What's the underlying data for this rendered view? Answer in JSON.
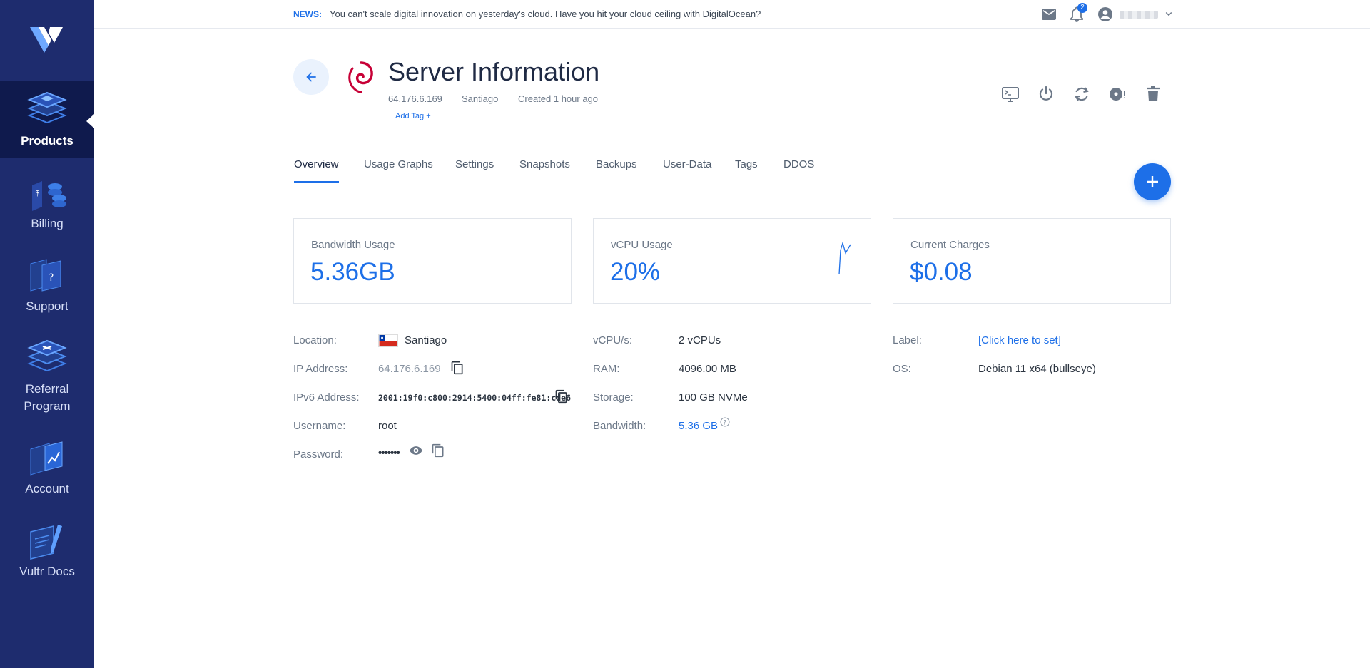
{
  "sidebar": {
    "items": [
      {
        "label": "Products",
        "icon": "products-icon",
        "active": true
      },
      {
        "label": "Billing",
        "icon": "billing-icon"
      },
      {
        "label": "Support",
        "icon": "support-icon"
      },
      {
        "label": "Referral Program",
        "line1": "Referral",
        "line2": "Program",
        "icon": "referral-icon"
      },
      {
        "label": "Account",
        "icon": "account-icon"
      },
      {
        "label": "Vultr Docs",
        "icon": "docs-icon"
      }
    ]
  },
  "topbar": {
    "news_tag": "NEWS:",
    "news_text": "You can't scale digital innovation on yesterday's cloud. Have you hit your cloud ceiling with DigitalOcean?",
    "notification_count": "2"
  },
  "header": {
    "title": "Server Information",
    "ip": "64.176.6.169",
    "location": "Santiago",
    "created": "Created 1 hour ago",
    "add_tag": "Add Tag +"
  },
  "tabs": [
    "Overview",
    "Usage Graphs",
    "Settings",
    "Snapshots",
    "Backups",
    "User-Data",
    "Tags",
    "DDOS"
  ],
  "cards": {
    "bandwidth": {
      "label": "Bandwidth Usage",
      "value": "5.36GB"
    },
    "vcpu": {
      "label": "vCPU Usage",
      "value": "20%"
    },
    "charges": {
      "label": "Current Charges",
      "value": "$0.08"
    }
  },
  "details": {
    "location_label": "Location:",
    "location_value": "Santiago",
    "ip_label": "IP Address:",
    "ip_value": "64.176.6.169",
    "ipv6_label": "IPv6 Address:",
    "ipv6_value": "2001:19f0:c800:2914:5400:04ff:fe81:cde6",
    "username_label": "Username:",
    "username_value": "root",
    "password_label": "Password:",
    "password_value": "•••••••",
    "vcpus_label": "vCPU/s:",
    "vcpus_value": "2 vCPUs",
    "ram_label": "RAM:",
    "ram_value": "4096.00 MB",
    "storage_label": "Storage:",
    "storage_value": "100 GB NVMe",
    "bandwidth_label": "Bandwidth:",
    "bandwidth_value": "5.36 GB",
    "label_label": "Label:",
    "label_value": "[Click here to set]",
    "os_label": "OS:",
    "os_value": "Debian 11 x64 (bullseye)"
  },
  "colors": {
    "sidebar": "#1e2c6e",
    "sidebar_active": "#0f1a4d",
    "accent": "#1d6fe8",
    "debian": "#c70036"
  }
}
